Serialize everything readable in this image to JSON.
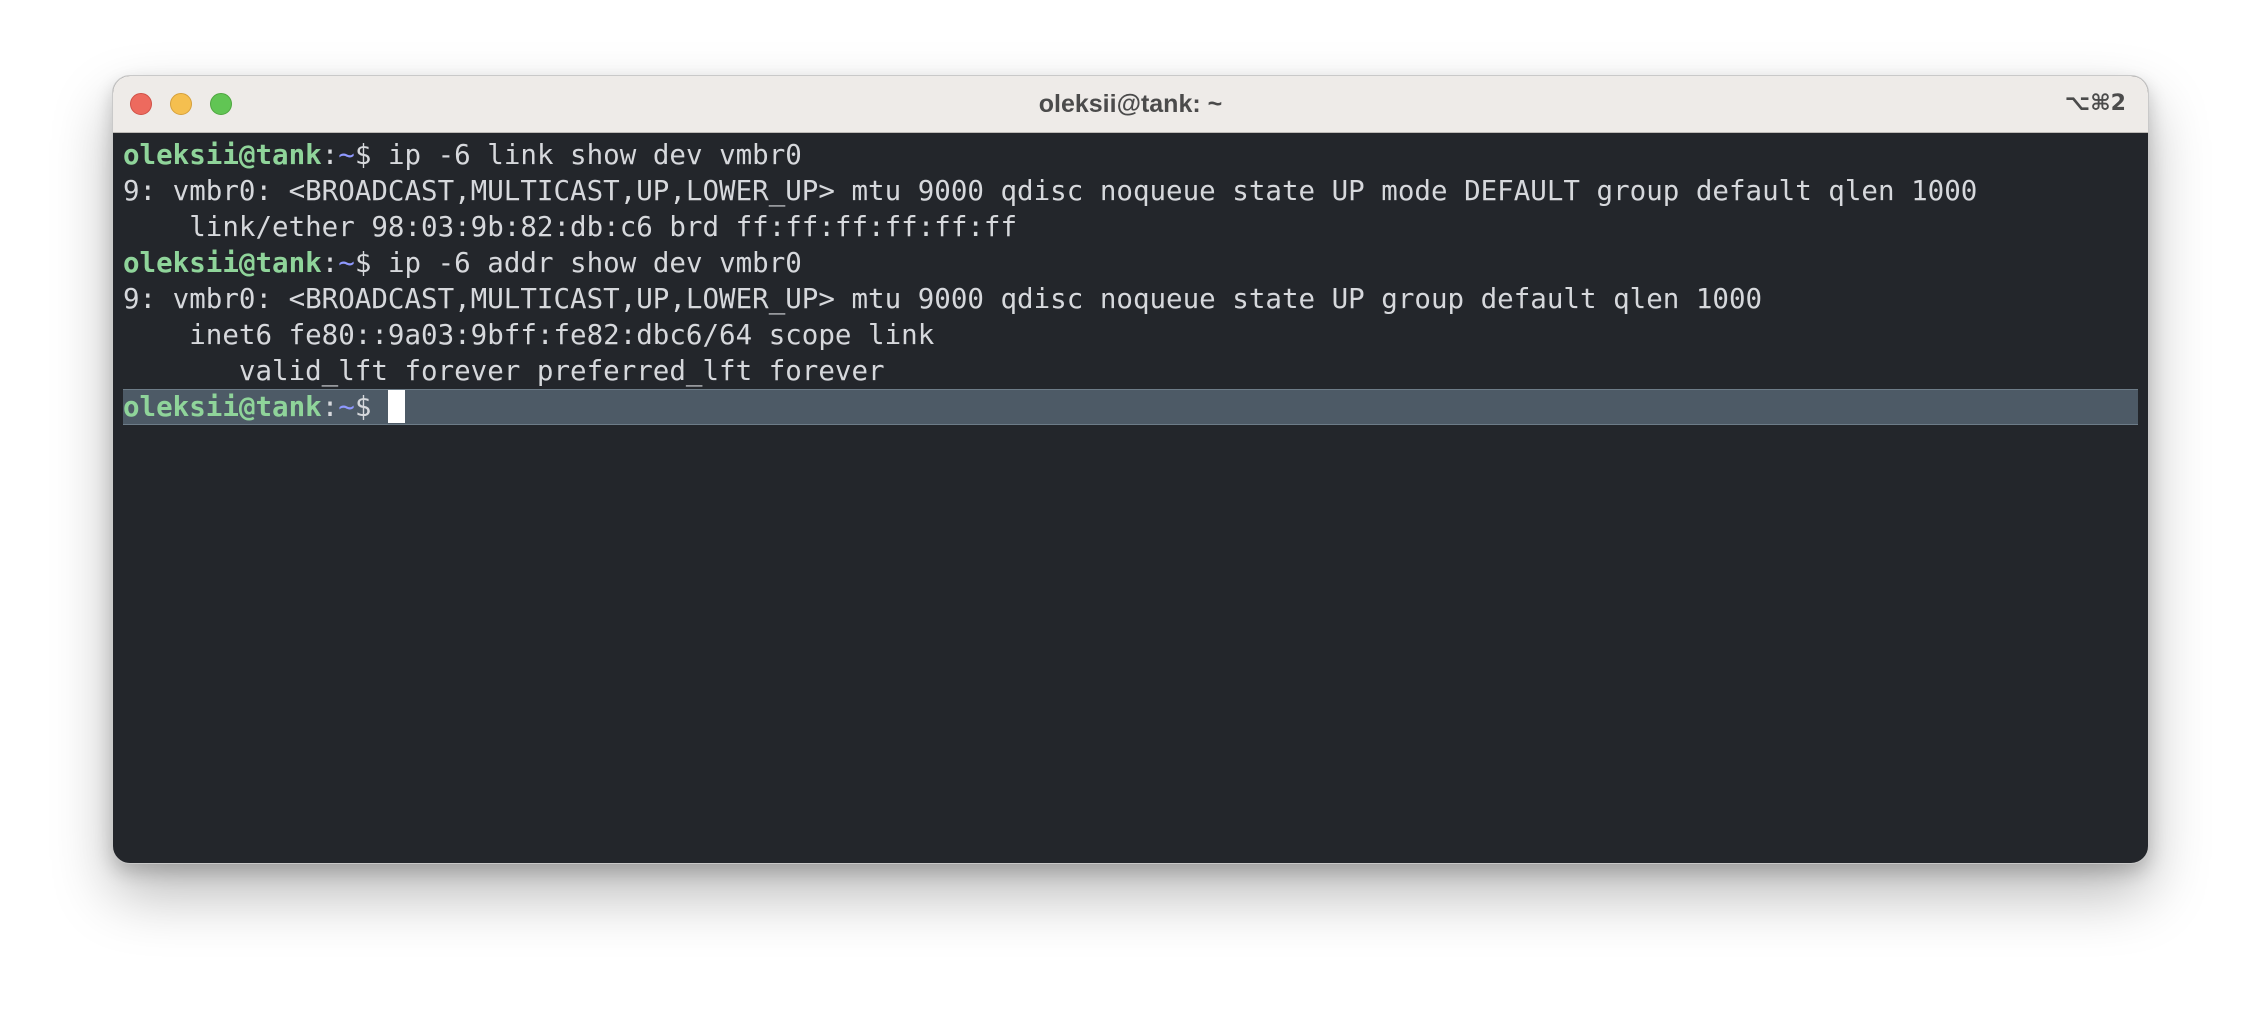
{
  "window": {
    "title": "oleksii@tank: ~",
    "shortcut": "⌥⌘2"
  },
  "terminal": {
    "prompt_user": "oleksii@tank",
    "prompt_colon": ":",
    "prompt_path": "~",
    "prompt_dollar": "$",
    "commands": [
      "ip -6 link show dev vmbr0",
      "ip -6 addr show dev vmbr0"
    ],
    "output": [
      "9: vmbr0: <BROADCAST,MULTICAST,UP,LOWER_UP> mtu 9000 qdisc noqueue state UP mode DEFAULT group default qlen 1000",
      "    link/ether 98:03:9b:82:db:c6 brd ff:ff:ff:ff:ff:ff",
      "9: vmbr0: <BROADCAST,MULTICAST,UP,LOWER_UP> mtu 9000 qdisc noqueue state UP group default qlen 1000",
      "    inet6 fe80::9a03:9bff:fe82:dbc6/64 scope link",
      "       valid_lft forever preferred_lft forever"
    ]
  },
  "colors": {
    "prompt_user": "#8fd49a",
    "prompt_path": "#8f99ff",
    "text": "#d6d8dc",
    "background": "#23262b",
    "active_line": "#4d5a66"
  }
}
